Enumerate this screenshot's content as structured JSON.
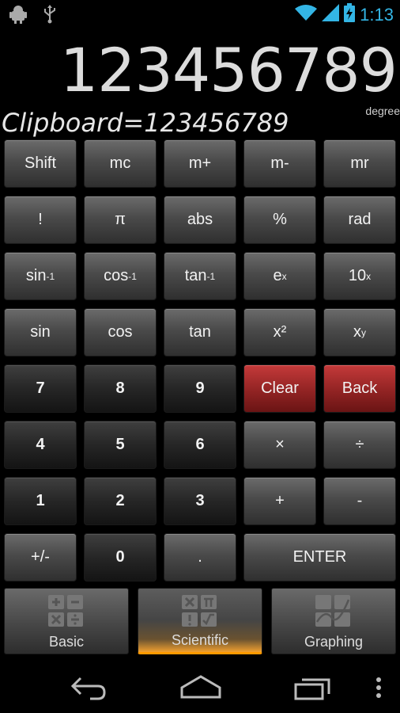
{
  "status_bar": {
    "time": "1:13",
    "icons": [
      "android-debug-icon",
      "usb-icon",
      "wifi-icon",
      "signal-icon",
      "battery-charging-icon"
    ]
  },
  "display": {
    "value": "123456789",
    "angle_mode": "degree",
    "clipboard": "Clipboard=123456789"
  },
  "keys": {
    "shift": "Shift",
    "mc": "mc",
    "mplus": "m+",
    "mminus": "m-",
    "mr": "mr",
    "fact": "!",
    "pi": "π",
    "abs": "abs",
    "percent": "%",
    "rad": "rad",
    "asin": "sin",
    "acos": "cos",
    "atan": "tan",
    "inv_sup": "-1",
    "exp_base": "e",
    "exp_sup": "x",
    "pow10_base": "10",
    "pow10_sup": "x",
    "sin": "sin",
    "cos": "cos",
    "tan": "tan",
    "sq": "x²",
    "pow_base": "x",
    "pow_sup": "y",
    "n7": "7",
    "n8": "8",
    "n9": "9",
    "clear": "Clear",
    "back": "Back",
    "n4": "4",
    "n5": "5",
    "n6": "6",
    "mul": "×",
    "div": "÷",
    "n1": "1",
    "n2": "2",
    "n3": "3",
    "add": "+",
    "sub": "-",
    "neg": "+/-",
    "n0": "0",
    "dot": ".",
    "enter": "ENTER"
  },
  "tabs": [
    {
      "label": "Basic",
      "active": false
    },
    {
      "label": "Scientific",
      "active": true
    },
    {
      "label": "Graphing",
      "active": false
    }
  ],
  "colors": {
    "accent_blue": "#33b5e5",
    "tab_active_orange": "#ff9900",
    "clear_red": "#962525"
  }
}
